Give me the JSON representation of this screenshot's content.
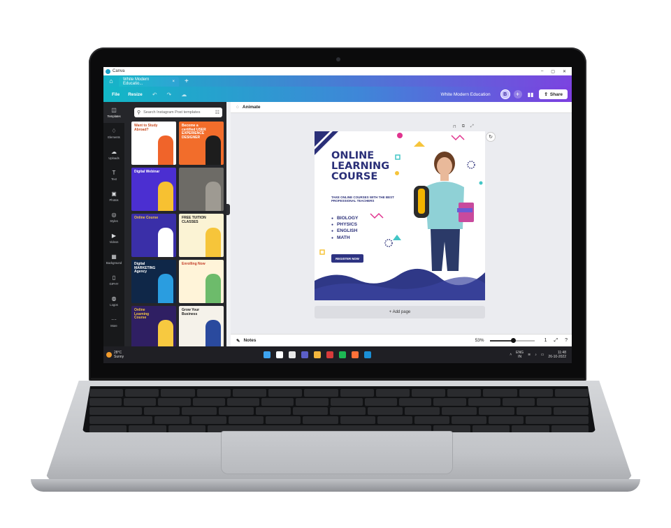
{
  "window": {
    "app_name": "Canva",
    "controls": [
      "–",
      "▢",
      "✕"
    ]
  },
  "tabs": {
    "home_icon": "home-icon",
    "doc_tab_label": "White Modern Educatio...",
    "close": "×",
    "new_tab": "+"
  },
  "menubar": {
    "file": "File",
    "resize": "Resize",
    "doc_title": "White Modern Education",
    "avatar_letter": "B",
    "plus": "+",
    "share": "Share"
  },
  "rail": [
    {
      "label": "Templates",
      "icon": "◫"
    },
    {
      "label": "Elements",
      "icon": "♢"
    },
    {
      "label": "Uploads",
      "icon": "☁"
    },
    {
      "label": "Text",
      "icon": "T"
    },
    {
      "label": "Photos",
      "icon": "▣"
    },
    {
      "label": "Styles",
      "icon": "◎"
    },
    {
      "label": "Videos",
      "icon": "▶"
    },
    {
      "label": "Background",
      "icon": "▦"
    },
    {
      "label": "GIPHY",
      "icon": "▯"
    },
    {
      "label": "Logos",
      "icon": "◍"
    },
    {
      "label": "More",
      "icon": "···"
    }
  ],
  "panel": {
    "search_placeholder": "Search Instagram Post templates",
    "thumbs": [
      {
        "text": "Want to Study Abroad?",
        "bg": "#ffffff",
        "fg": "#c84a1e",
        "accent": "#f0642a"
      },
      {
        "text": "Become a certified USER EXPERIENCE DESIGNER",
        "bg": "#f26d2b",
        "fg": "#ffffff",
        "accent": "#1d1d1d"
      },
      {
        "text": "Digital Webinar",
        "bg": "#4b2fd1",
        "fg": "#ffffff",
        "accent": "#f7c131"
      },
      {
        "text": "",
        "bg": "#6d6b66",
        "fg": "#ffffff",
        "accent": "#9e9a92"
      },
      {
        "text": "Online Course",
        "bg": "#3a2fa8",
        "fg": "#f7c940",
        "accent": "#ffffff"
      },
      {
        "text": "FREE TUITION CLASSES",
        "bg": "#fbf3d4",
        "fg": "#1d1d1d",
        "accent": "#f6c53a"
      },
      {
        "text": "Digital MARKETING Agency",
        "bg": "#0f2748",
        "fg": "#ffffff",
        "accent": "#2a9de0"
      },
      {
        "text": "Enrolling Now",
        "bg": "#fff4d9",
        "fg": "#c4402a",
        "accent": "#6dbb6b"
      },
      {
        "text": "Online Learning Course",
        "bg": "#2f1f63",
        "fg": "#f7c940",
        "accent": "#f7c940"
      },
      {
        "text": "Grow Your Business",
        "bg": "#f5f2ea",
        "fg": "#1d1d1d",
        "accent": "#2a4a9e"
      }
    ]
  },
  "canvas": {
    "animate": "Animate",
    "add_page": "+ Add page",
    "design": {
      "headline": "ONLINE LEARNING COURSE",
      "sub": "TAKE ONLINE COURSES WITH THE BEST PROFESSIONAL TEACHERS",
      "subjects": [
        "BIOLOGY",
        "PHYSICS",
        "ENGLISH",
        "MATH"
      ],
      "cta": "REGISTER NOW",
      "primary_color": "#2a2f78",
      "accent_pink": "#e0348f",
      "accent_teal": "#43c6c6",
      "accent_yellow": "#f6c43a"
    }
  },
  "bottombar": {
    "notes": "Notes",
    "zoom": "53%",
    "zoom_fraction": 0.53,
    "page_count": "1"
  },
  "taskbar": {
    "temp": "28°C",
    "weather": "Sunny",
    "lang": "ENG",
    "region": "IN",
    "time": "11:48",
    "date": "26-10-2022",
    "apps": [
      "#3ea4f0",
      "#ffffff",
      "#e8e8e8",
      "#5b5fc7",
      "#f3b63d",
      "#d83b3b",
      "#1db954",
      "#ff7139",
      "#1a8fd6"
    ]
  }
}
